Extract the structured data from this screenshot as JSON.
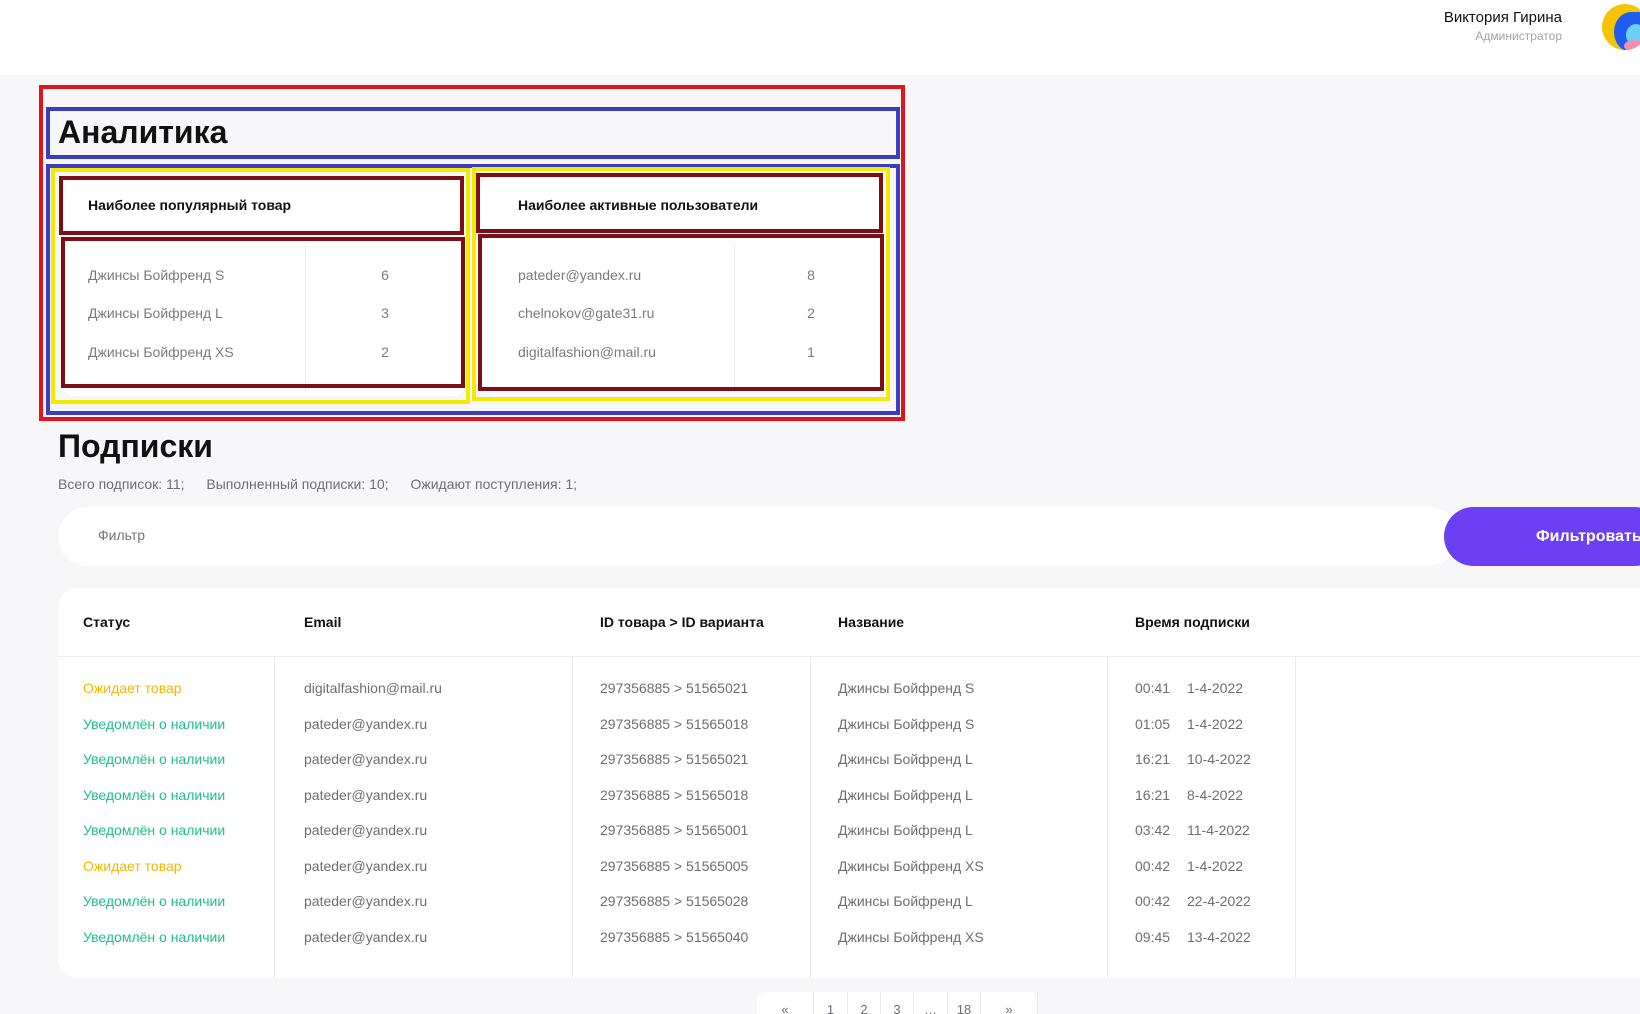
{
  "user": {
    "name": "Виктория Гирина",
    "role": "Администратор"
  },
  "analytics": {
    "title": "Аналитика",
    "popular": {
      "heading": "Наиболее популярный товар",
      "rows": [
        {
          "name": "Джинсы Бойфренд S",
          "count": "6"
        },
        {
          "name": "Джинсы Бойфренд L",
          "count": "3"
        },
        {
          "name": "Джинсы Бойфренд XS",
          "count": "2"
        }
      ]
    },
    "active_users": {
      "heading": "Наиболее активные пользователи",
      "rows": [
        {
          "email": "pateder@yandex.ru",
          "count": "8"
        },
        {
          "email": "chelnokov@gate31.ru",
          "count": "2"
        },
        {
          "email": "digitalfashion@mail.ru",
          "count": "1"
        }
      ]
    }
  },
  "subscriptions": {
    "title": "Подписки",
    "summary": {
      "total": "Всего подписок: 11;",
      "done": "Выполненный подписки: 10;",
      "waiting": "Ожидают поступления: 1;"
    },
    "filter": {
      "placeholder": "Фильтр",
      "button": "Фильтровать"
    },
    "columns": [
      "Статус",
      "Email",
      "ID товара > ID варианта",
      "Название",
      "Время подписки"
    ],
    "rows": [
      {
        "status": "Ожидает товар",
        "status_type": "wait",
        "email": "digitalfashion@mail.ru",
        "ids": "297356885 > 51565021",
        "name": "Джинсы Бойфренд S",
        "time": "00:41",
        "date": "1-4-2022"
      },
      {
        "status": "Уведомлён о наличии",
        "status_type": "ok",
        "email": "pateder@yandex.ru",
        "ids": "297356885 > 51565018",
        "name": "Джинсы Бойфренд S",
        "time": "01:05",
        "date": "1-4-2022"
      },
      {
        "status": "Уведомлён о наличии",
        "status_type": "ok",
        "email": "pateder@yandex.ru",
        "ids": "297356885 > 51565021",
        "name": "Джинсы Бойфренд L",
        "time": "16:21",
        "date": "10-4-2022"
      },
      {
        "status": "Уведомлён о наличии",
        "status_type": "ok",
        "email": "pateder@yandex.ru",
        "ids": "297356885 > 51565018",
        "name": "Джинсы Бойфренд L",
        "time": "16:21",
        "date": "8-4-2022"
      },
      {
        "status": "Уведомлён о наличии",
        "status_type": "ok",
        "email": "pateder@yandex.ru",
        "ids": "297356885 > 51565001",
        "name": "Джинсы Бойфренд L",
        "time": "03:42",
        "date": "11-4-2022"
      },
      {
        "status": "Ожидает товар",
        "status_type": "wait",
        "email": "pateder@yandex.ru",
        "ids": "297356885 > 51565005",
        "name": "Джинсы Бойфренд XS",
        "time": "00:42",
        "date": "1-4-2022"
      },
      {
        "status": "Уведомлён о наличии",
        "status_type": "ok",
        "email": "pateder@yandex.ru",
        "ids": "297356885 > 51565028",
        "name": "Джинсы Бойфренд L",
        "time": "00:42",
        "date": "22-4-2022"
      },
      {
        "status": "Уведомлён о наличии",
        "status_type": "ok",
        "email": "pateder@yandex.ru",
        "ids": "297356885 > 51565040",
        "name": "Джинсы Бойфренд XS",
        "time": "09:45",
        "date": "13-4-2022"
      }
    ]
  },
  "pagination": {
    "items": [
      "«",
      "1",
      "2",
      "3",
      "…",
      "18",
      "»"
    ]
  },
  "colors": {
    "accent": "#6b3ff2",
    "status_wait": "#f2b800",
    "status_ok": "#1fbf8a"
  },
  "icons": {
    "avatar": "user-avatar"
  }
}
